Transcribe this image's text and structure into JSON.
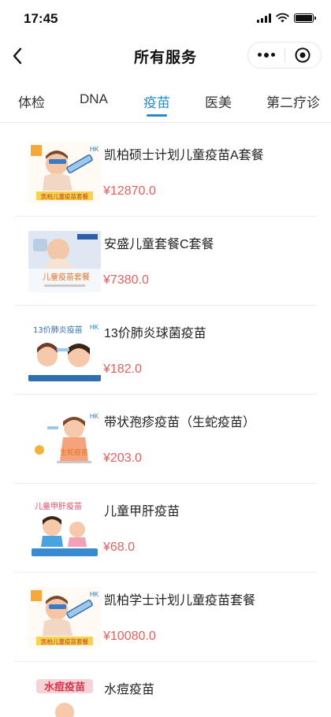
{
  "status_bar": {
    "time": "17:45"
  },
  "nav": {
    "title": "所有服务"
  },
  "tabs": [
    {
      "label": "体检"
    },
    {
      "label": "DNA"
    },
    {
      "label": "疫苗"
    },
    {
      "label": "医美"
    },
    {
      "label": "第二疗诊"
    }
  ],
  "products": [
    {
      "name": "凯柏硕士计划儿童疫苗A套餐",
      "price": "¥12870.0",
      "thumb_icon": "baby-vaccine-syringe-image",
      "thumb_caption": "凯柏儿童疫苗套餐"
    },
    {
      "name": "安盛儿童套餐C套餐",
      "price": "¥7380.0",
      "thumb_icon": "child-vaccine-package-photo",
      "thumb_caption": "儿童疫苗套餐"
    },
    {
      "name": "13价肺炎球菌疫苗",
      "price": "¥182.0",
      "thumb_icon": "pneumococcal-vaccine-cartoon",
      "thumb_caption": "13价肺炎疫苗"
    },
    {
      "name": "带状孢疹疫苗（生蛇疫苗）",
      "price": "¥203.0",
      "thumb_icon": "shingles-vaccine-cartoon",
      "thumb_caption": "生蛇疫苗"
    },
    {
      "name": "儿童甲肝疫苗",
      "price": "¥68.0",
      "thumb_icon": "hepatitis-a-vaccine-cartoon",
      "thumb_caption": "儿童甲肝疫苗"
    },
    {
      "name": "凯柏学士计划儿童疫苗套餐",
      "price": "¥10080.0",
      "thumb_icon": "baby-vaccine-syringe-image",
      "thumb_caption": "凯柏儿童疫苗套餐"
    },
    {
      "name": "水痘疫苗",
      "price": "",
      "thumb_icon": "chickenpox-vaccine-cartoon",
      "thumb_caption": "水痘疫苗"
    }
  ],
  "colors": {
    "accent": "#2a8ac6",
    "price": "#e06060"
  }
}
